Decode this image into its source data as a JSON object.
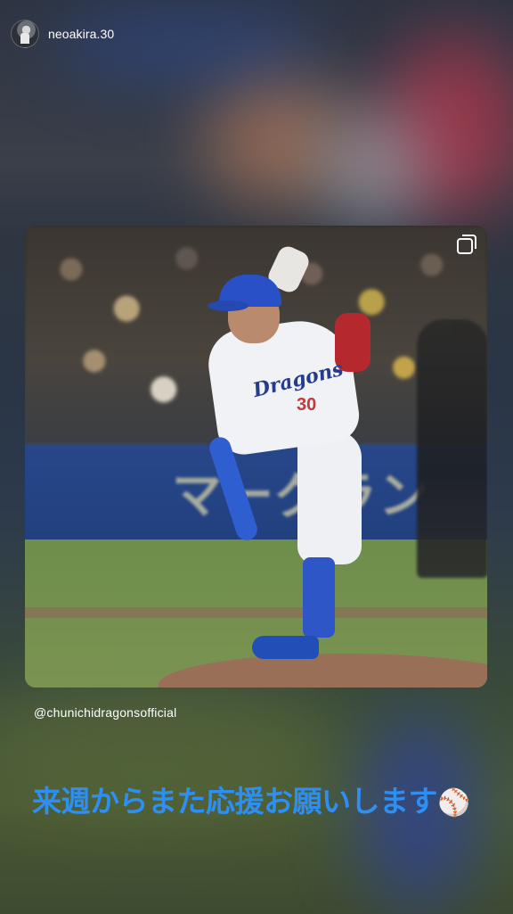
{
  "story": {
    "username": "neoakira.30",
    "mention": "@chunichidragonsofficial",
    "caption": "来週からまた応援お願いします",
    "caption_emoji": "⚾"
  },
  "post_image": {
    "jersey_text": "Dragons",
    "jersey_number": "30",
    "wall_text": "マーグラン"
  },
  "colors": {
    "caption": "#2e8ff2"
  }
}
